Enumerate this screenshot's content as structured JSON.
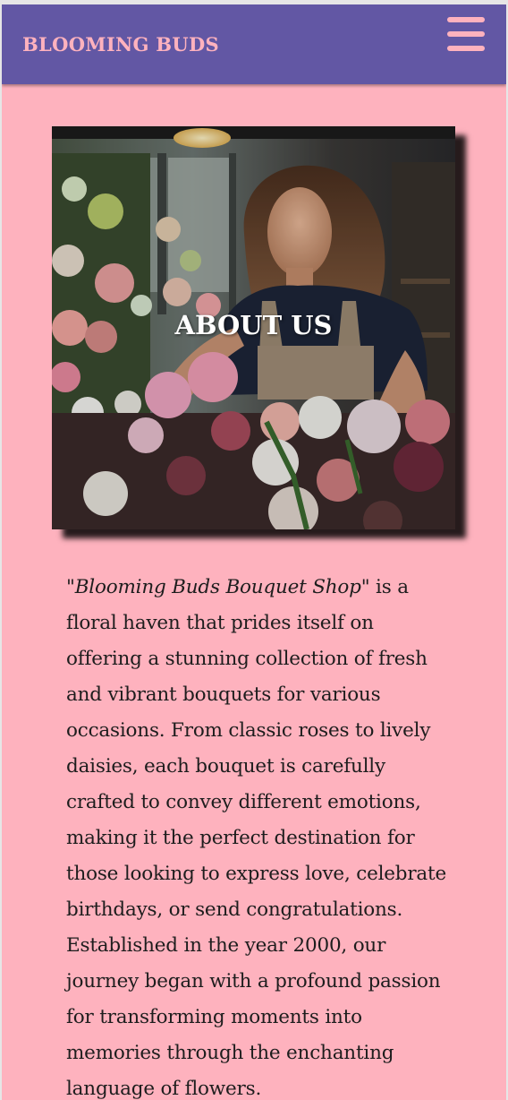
{
  "navbar": {
    "brand": "BLOOMING BUDS",
    "menu_icon": "hamburger-menu-icon"
  },
  "hero": {
    "title": "ABOUT US",
    "image": "florist-arranging-bouquet-photo"
  },
  "about": {
    "shop_name": "\"Blooming Buds Bouquet Shop\"",
    "body": " is a floral haven that prides itself on offering a stunning collection of fresh and vibrant bouquets for various occasions. From classic roses to lively daisies, each bouquet is carefully crafted to convey different emotions, making it the perfect destination for those looking to express love, celebrate birthdays, or send congratulations. Established in the year 2000, our journey began with a profound passion for transforming moments into memories through the enchanting language of flowers."
  },
  "colors": {
    "navbar": "#6257a4",
    "page_background": "#feb2be",
    "brand_text": "#feb2be"
  }
}
